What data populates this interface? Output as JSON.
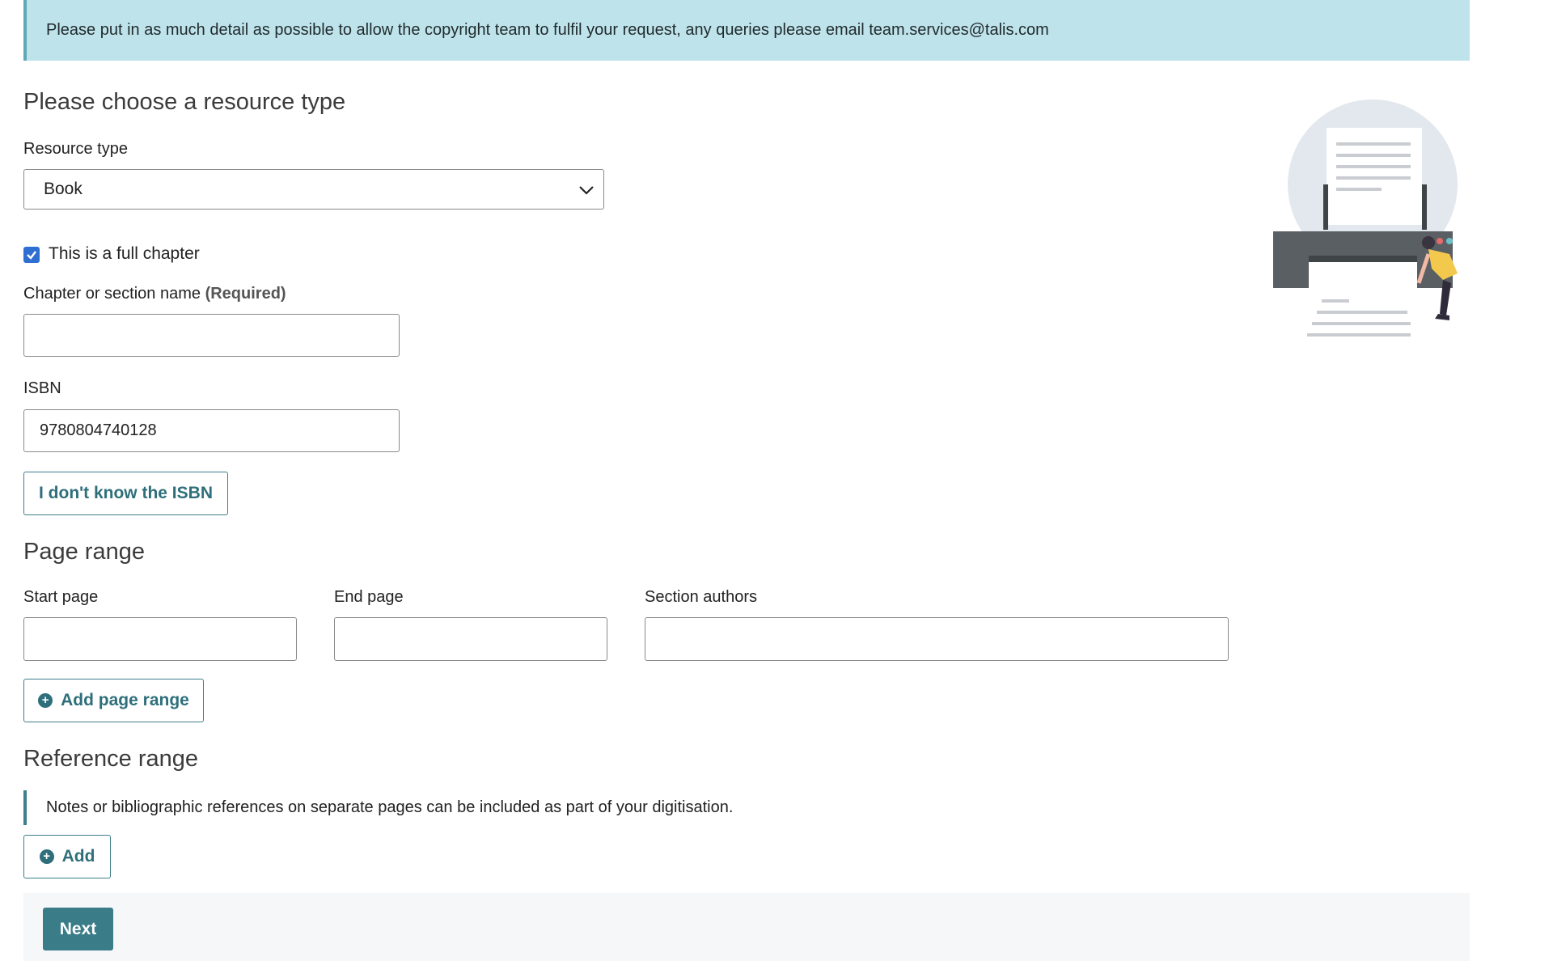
{
  "banner": {
    "text": "Please put in as much detail as possible to allow the copyright team to fulfil your request, any queries please email team.services@talis.com"
  },
  "resource": {
    "heading": "Please choose a resource type",
    "type_label": "Resource type",
    "type_value": "Book",
    "full_chapter_label": "This is a full chapter",
    "full_chapter_checked": true
  },
  "chapter": {
    "label": "Chapter or section name",
    "required": "(Required)",
    "value": ""
  },
  "isbn": {
    "label": "ISBN",
    "value": "9780804740128",
    "unknown_button": "I don't know the ISBN"
  },
  "page_range": {
    "heading": "Page range",
    "start_label": "Start page",
    "end_label": "End page",
    "authors_label": "Section authors",
    "add_button": "Add page range"
  },
  "reference_range": {
    "heading": "Reference range",
    "note": "Notes or bibliographic references on separate pages can be included as part of your digitisation.",
    "add_button": "Add"
  },
  "footer": {
    "next_button": "Next"
  },
  "icons": {
    "dropdown": "chevron-down-icon",
    "checkbox": "checkmark-icon",
    "add": "plus-circle-icon",
    "illustration": "printer-illustration"
  }
}
